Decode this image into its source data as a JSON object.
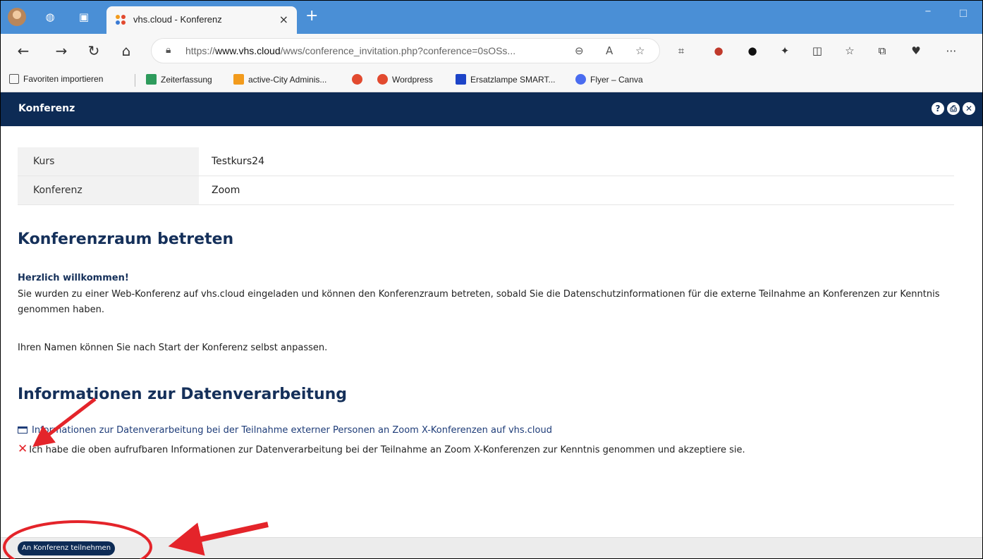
{
  "browser": {
    "tab_title": "vhs.cloud - Konferenz",
    "tab_close": "×",
    "new_tab": "+",
    "url_prefix": "https://",
    "url_domain": "www.vhs.cloud",
    "url_path": "/wws/conference_invitation.php?conference=0sOSs...",
    "bookmarks": [
      {
        "label": "Favoriten importieren",
        "color": "#555555"
      },
      {
        "label": "Zeiterfassung",
        "color": "#2e9b5c"
      },
      {
        "label": "active-City Adminis...",
        "color": "#f29b1d"
      },
      {
        "label": "",
        "color": "#e24a2f"
      },
      {
        "label": "Wordpress",
        "color": "#e24a2f"
      },
      {
        "label": "Ersatzlampe SMART...",
        "color": "#1d44c8"
      },
      {
        "label": "Flyer – Canva",
        "color": "#4a6cf0"
      }
    ]
  },
  "app": {
    "header_title": "Konferenz",
    "header_icons": [
      "help-icon",
      "print-icon",
      "close-icon"
    ],
    "info_table": [
      {
        "key": "Kurs",
        "value": "Testkurs24"
      },
      {
        "key": "Konferenz",
        "value": "Zoom"
      }
    ],
    "section1_title": "Konferenzraum betreten",
    "welcome": "Herzlich willkommen!",
    "paragraph1": "Sie wurden zu einer Web-Konferenz auf vhs.cloud eingeladen und können den Konferenzraum betreten, sobald Sie die Datenschutzinformationen für die externe Teilnahme an Konferenzen zur Kenntnis genommen haben.",
    "paragraph2": "Ihren Namen können Sie nach Start der Konferenz selbst anpassen.",
    "section2_title": "Informationen zur Datenverarbeitung",
    "privacy_link": "Informationen zur Datenverarbeitung bei der Teilnahme externer Personen an Zoom X-Konferenzen auf vhs.cloud",
    "consent_text": "Ich habe die oben aufrufbaren Informationen zur Datenverarbeitung bei der Teilnahme an Zoom X-Konferenzen zur Kenntnis genommen und akzeptiere sie.",
    "join_button": "An Konferenz teilnehmen"
  },
  "colors": {
    "header": "#0d2b55",
    "tabbar": "#4a8fd6",
    "annotation": "#e4242a"
  }
}
